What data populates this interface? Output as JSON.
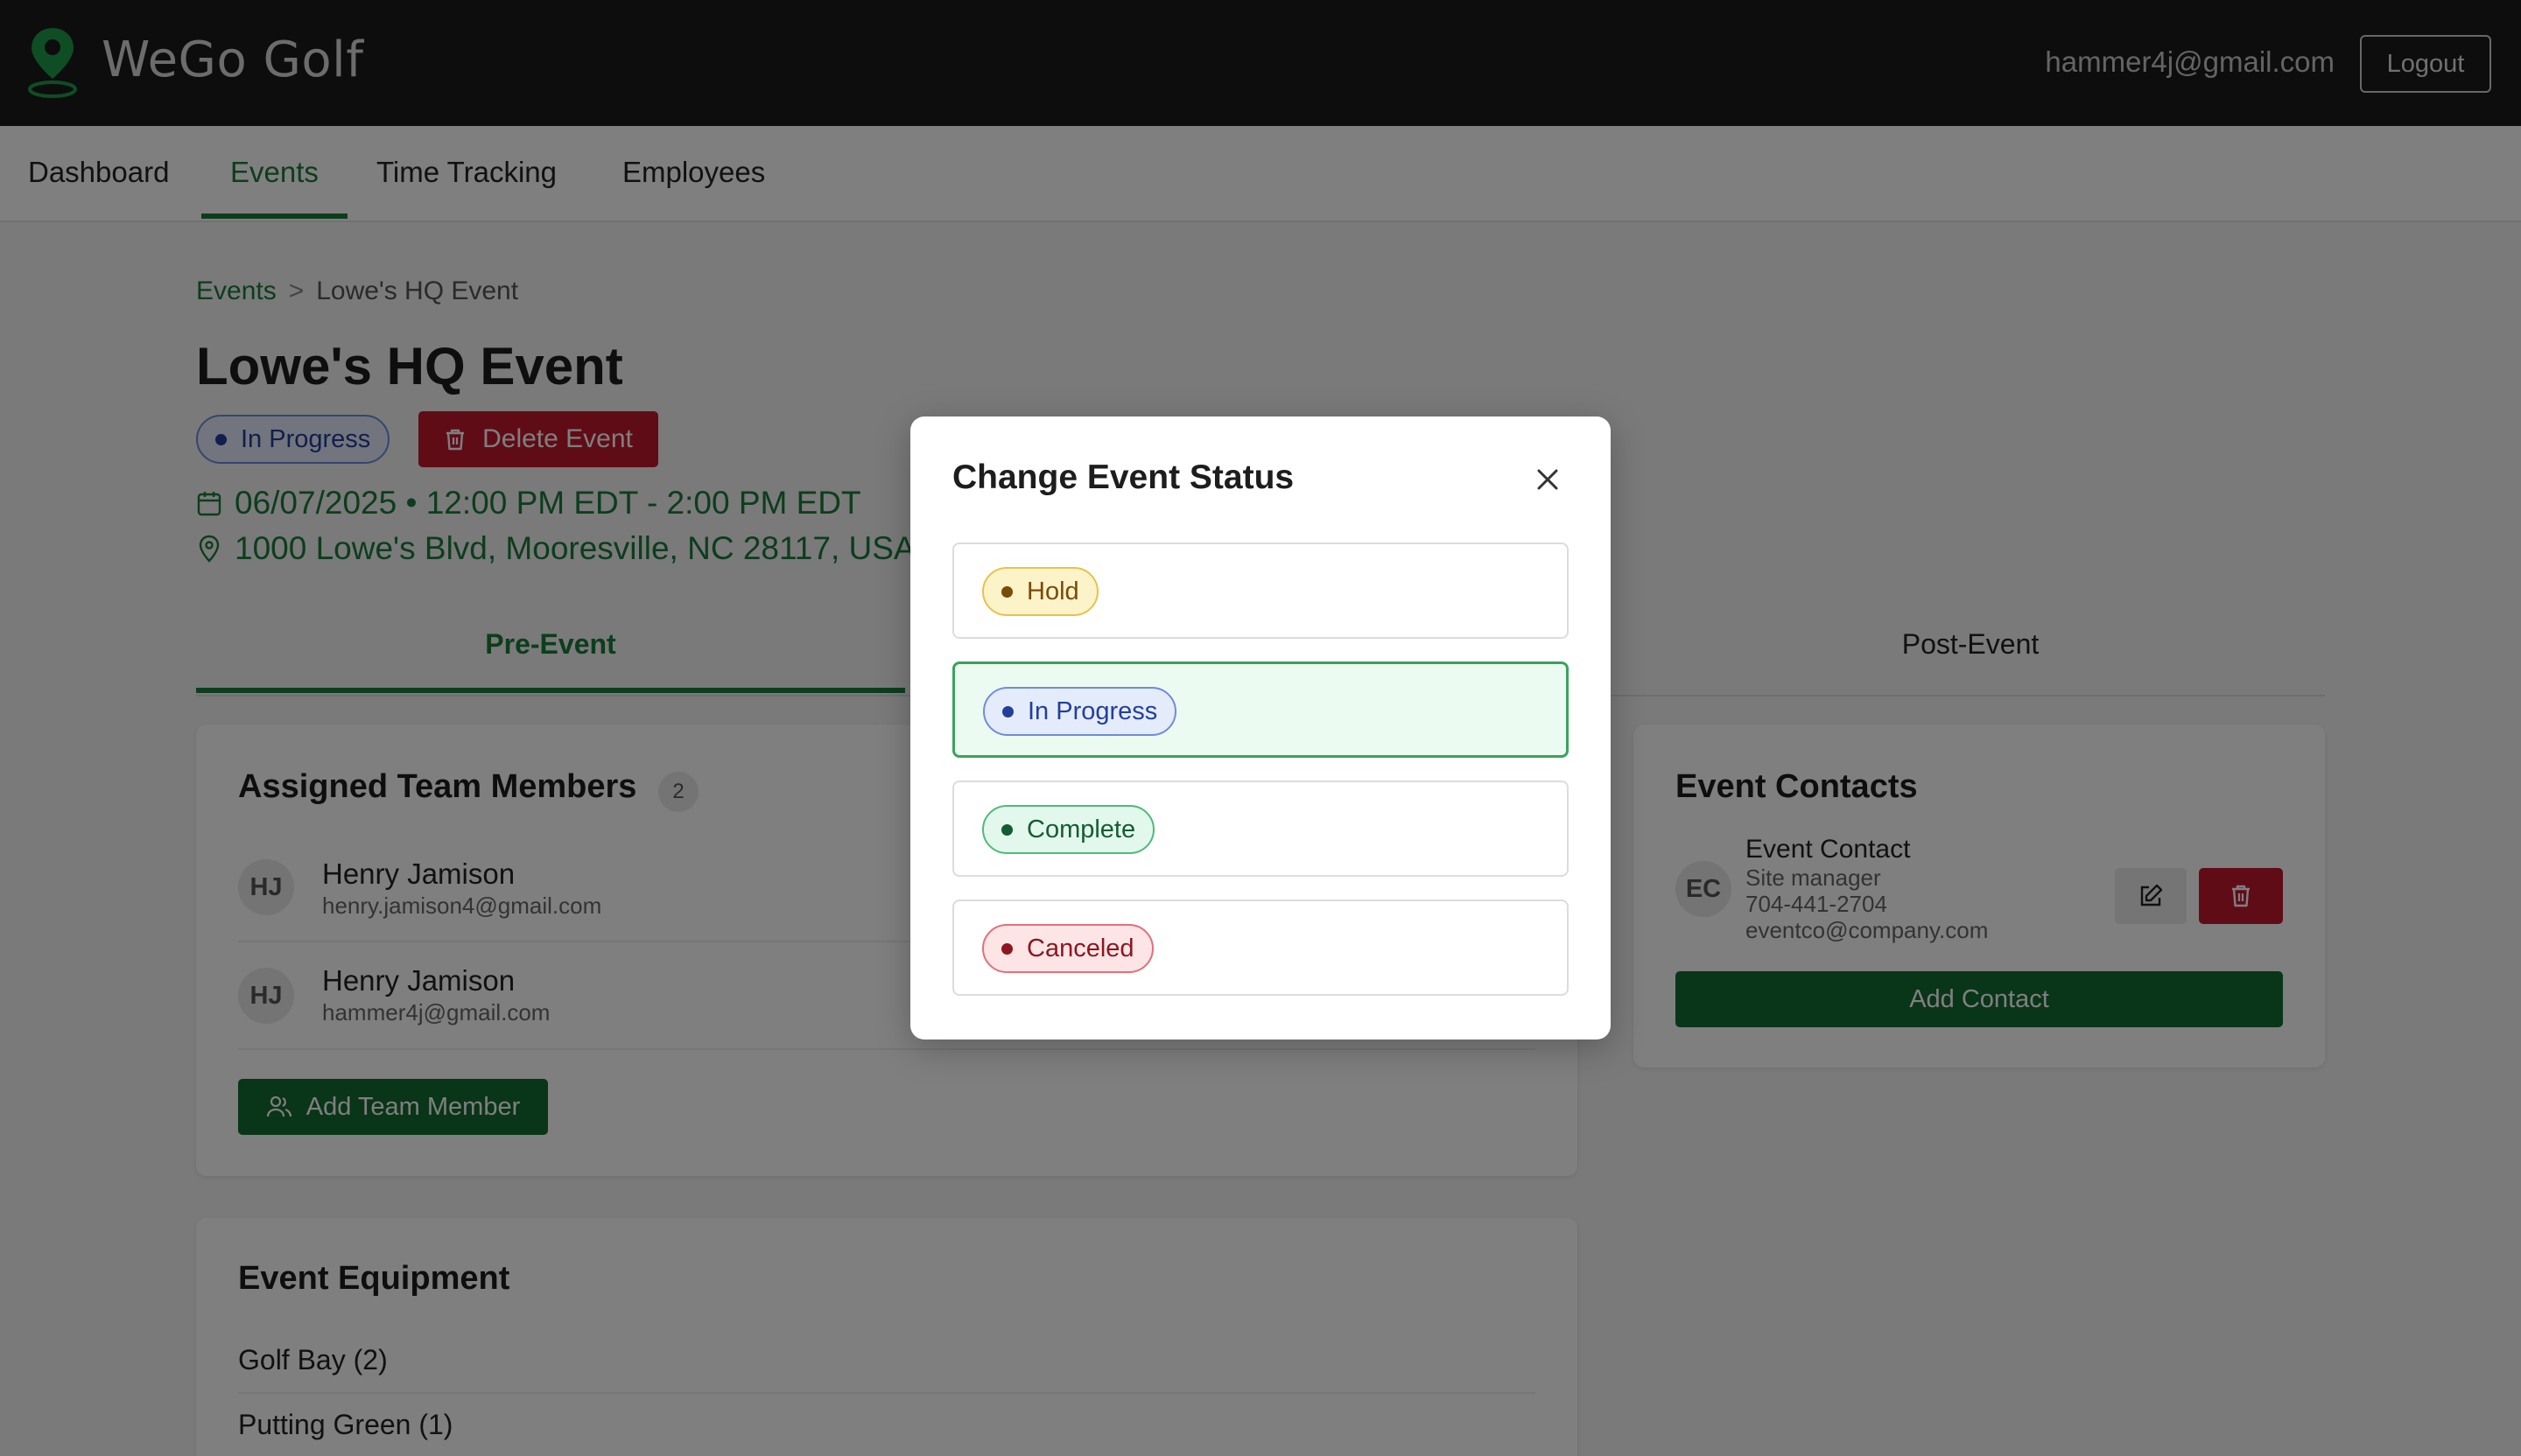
{
  "header": {
    "brand": "WeGo Golf",
    "user_email": "hammer4j@gmail.com",
    "logout_label": "Logout",
    "brand_color": "#1a7a3a"
  },
  "nav": {
    "items": [
      {
        "label": "Dashboard"
      },
      {
        "label": "Events"
      },
      {
        "label": "Time Tracking"
      },
      {
        "label": "Employees"
      }
    ],
    "active": "Events"
  },
  "breadcrumb": {
    "root": "Events",
    "separator": ">",
    "current": "Lowe's HQ Event"
  },
  "event": {
    "title": "Lowe's HQ Event",
    "status": "In Progress",
    "delete_label": "Delete Event",
    "datetime": "06/07/2025 • 12:00 PM EDT - 2:00 PM EDT",
    "address": "1000 Lowe's Blvd, Mooresville, NC 28117, USA"
  },
  "tabs": [
    {
      "label": "Pre-Event"
    },
    {
      "label": "Post-Event"
    }
  ],
  "team": {
    "title": "Assigned Team Members",
    "count": "2",
    "members": [
      {
        "initials": "HJ",
        "name": "Henry Jamison",
        "email": "henry.jamison4@gmail.com"
      },
      {
        "initials": "HJ",
        "name": "Henry Jamison",
        "email": "hammer4j@gmail.com"
      }
    ],
    "add_label": "Add Team Member"
  },
  "equipment": {
    "title": "Event Equipment",
    "items": [
      "Golf Bay (2)",
      "Putting Green (1)"
    ]
  },
  "contacts": {
    "title": "Event Contacts",
    "items": [
      {
        "initials": "EC",
        "name": "Event Contact",
        "role": "Site manager",
        "phone": "704-441-2704",
        "email": "eventco@company.com"
      }
    ],
    "add_label": "Add Contact"
  },
  "modal": {
    "title": "Change Event Status",
    "options": [
      {
        "label": "Hold",
        "color": "#e7c24a"
      },
      {
        "label": "In Progress",
        "color": "#6d8dd8"
      },
      {
        "label": "Complete",
        "color": "#4cbb78"
      },
      {
        "label": "Canceled",
        "color": "#e36f79"
      }
    ],
    "selected": "In Progress"
  }
}
